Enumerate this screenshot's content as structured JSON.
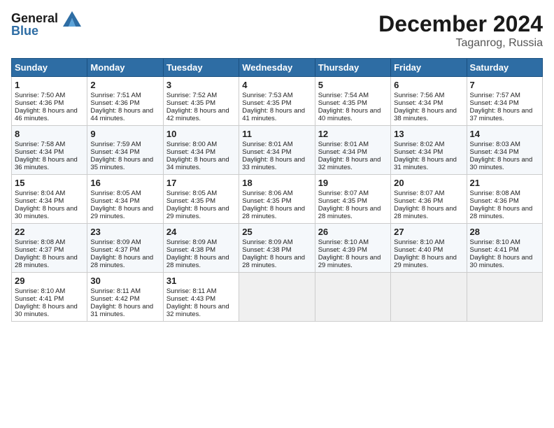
{
  "header": {
    "logo_line1": "General",
    "logo_line2": "Blue",
    "month": "December 2024",
    "location": "Taganrog, Russia"
  },
  "days_of_week": [
    "Sunday",
    "Monday",
    "Tuesday",
    "Wednesday",
    "Thursday",
    "Friday",
    "Saturday"
  ],
  "weeks": [
    [
      {
        "day": 1,
        "sunrise": "7:50 AM",
        "sunset": "4:36 PM",
        "daylight": "8 hours and 46 minutes."
      },
      {
        "day": 2,
        "sunrise": "7:51 AM",
        "sunset": "4:36 PM",
        "daylight": "8 hours and 44 minutes."
      },
      {
        "day": 3,
        "sunrise": "7:52 AM",
        "sunset": "4:35 PM",
        "daylight": "8 hours and 42 minutes."
      },
      {
        "day": 4,
        "sunrise": "7:53 AM",
        "sunset": "4:35 PM",
        "daylight": "8 hours and 41 minutes."
      },
      {
        "day": 5,
        "sunrise": "7:54 AM",
        "sunset": "4:35 PM",
        "daylight": "8 hours and 40 minutes."
      },
      {
        "day": 6,
        "sunrise": "7:56 AM",
        "sunset": "4:34 PM",
        "daylight": "8 hours and 38 minutes."
      },
      {
        "day": 7,
        "sunrise": "7:57 AM",
        "sunset": "4:34 PM",
        "daylight": "8 hours and 37 minutes."
      }
    ],
    [
      {
        "day": 8,
        "sunrise": "7:58 AM",
        "sunset": "4:34 PM",
        "daylight": "8 hours and 36 minutes."
      },
      {
        "day": 9,
        "sunrise": "7:59 AM",
        "sunset": "4:34 PM",
        "daylight": "8 hours and 35 minutes."
      },
      {
        "day": 10,
        "sunrise": "8:00 AM",
        "sunset": "4:34 PM",
        "daylight": "8 hours and 34 minutes."
      },
      {
        "day": 11,
        "sunrise": "8:01 AM",
        "sunset": "4:34 PM",
        "daylight": "8 hours and 33 minutes."
      },
      {
        "day": 12,
        "sunrise": "8:01 AM",
        "sunset": "4:34 PM",
        "daylight": "8 hours and 32 minutes."
      },
      {
        "day": 13,
        "sunrise": "8:02 AM",
        "sunset": "4:34 PM",
        "daylight": "8 hours and 31 minutes."
      },
      {
        "day": 14,
        "sunrise": "8:03 AM",
        "sunset": "4:34 PM",
        "daylight": "8 hours and 30 minutes."
      }
    ],
    [
      {
        "day": 15,
        "sunrise": "8:04 AM",
        "sunset": "4:34 PM",
        "daylight": "8 hours and 30 minutes."
      },
      {
        "day": 16,
        "sunrise": "8:05 AM",
        "sunset": "4:34 PM",
        "daylight": "8 hours and 29 minutes."
      },
      {
        "day": 17,
        "sunrise": "8:05 AM",
        "sunset": "4:35 PM",
        "daylight": "8 hours and 29 minutes."
      },
      {
        "day": 18,
        "sunrise": "8:06 AM",
        "sunset": "4:35 PM",
        "daylight": "8 hours and 28 minutes."
      },
      {
        "day": 19,
        "sunrise": "8:07 AM",
        "sunset": "4:35 PM",
        "daylight": "8 hours and 28 minutes."
      },
      {
        "day": 20,
        "sunrise": "8:07 AM",
        "sunset": "4:36 PM",
        "daylight": "8 hours and 28 minutes."
      },
      {
        "day": 21,
        "sunrise": "8:08 AM",
        "sunset": "4:36 PM",
        "daylight": "8 hours and 28 minutes."
      }
    ],
    [
      {
        "day": 22,
        "sunrise": "8:08 AM",
        "sunset": "4:37 PM",
        "daylight": "8 hours and 28 minutes."
      },
      {
        "day": 23,
        "sunrise": "8:09 AM",
        "sunset": "4:37 PM",
        "daylight": "8 hours and 28 minutes."
      },
      {
        "day": 24,
        "sunrise": "8:09 AM",
        "sunset": "4:38 PM",
        "daylight": "8 hours and 28 minutes."
      },
      {
        "day": 25,
        "sunrise": "8:09 AM",
        "sunset": "4:38 PM",
        "daylight": "8 hours and 28 minutes."
      },
      {
        "day": 26,
        "sunrise": "8:10 AM",
        "sunset": "4:39 PM",
        "daylight": "8 hours and 29 minutes."
      },
      {
        "day": 27,
        "sunrise": "8:10 AM",
        "sunset": "4:40 PM",
        "daylight": "8 hours and 29 minutes."
      },
      {
        "day": 28,
        "sunrise": "8:10 AM",
        "sunset": "4:41 PM",
        "daylight": "8 hours and 30 minutes."
      }
    ],
    [
      {
        "day": 29,
        "sunrise": "8:10 AM",
        "sunset": "4:41 PM",
        "daylight": "8 hours and 30 minutes."
      },
      {
        "day": 30,
        "sunrise": "8:11 AM",
        "sunset": "4:42 PM",
        "daylight": "8 hours and 31 minutes."
      },
      {
        "day": 31,
        "sunrise": "8:11 AM",
        "sunset": "4:43 PM",
        "daylight": "8 hours and 32 minutes."
      },
      null,
      null,
      null,
      null
    ]
  ]
}
